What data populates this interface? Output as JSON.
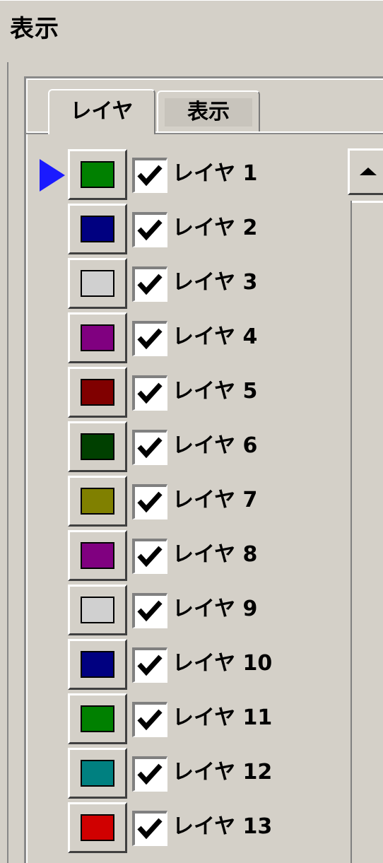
{
  "header": {
    "title": "表示"
  },
  "tabs": [
    {
      "label": "レイヤ",
      "active": true
    },
    {
      "label": "表示",
      "active": false
    }
  ],
  "layers": [
    {
      "label": "レイヤ 1",
      "color": "#008000",
      "checked": true,
      "selected": true
    },
    {
      "label": "レイヤ 2",
      "color": "#000080",
      "checked": true
    },
    {
      "label": "レイヤ 3",
      "color": "#d0d0d0",
      "checked": true
    },
    {
      "label": "レイヤ 4",
      "color": "#800080",
      "checked": true
    },
    {
      "label": "レイヤ 5",
      "color": "#800000",
      "checked": true
    },
    {
      "label": "レイヤ 6",
      "color": "#004000",
      "checked": true
    },
    {
      "label": "レイヤ 7",
      "color": "#808000",
      "checked": true
    },
    {
      "label": "レイヤ 8",
      "color": "#800080",
      "checked": true
    },
    {
      "label": "レイヤ 9",
      "color": "#d0d0d0",
      "checked": true
    },
    {
      "label": "レイヤ 10",
      "color": "#000080",
      "checked": true
    },
    {
      "label": "レイヤ 11",
      "color": "#008000",
      "checked": true
    },
    {
      "label": "レイヤ 12",
      "color": "#008080",
      "checked": true
    },
    {
      "label": "レイヤ 13",
      "color": "#d00000",
      "checked": true
    }
  ],
  "scrollbar": {
    "up_icon": "triangle-up-icon"
  },
  "selection_marker_icon": "triangle-right-icon"
}
